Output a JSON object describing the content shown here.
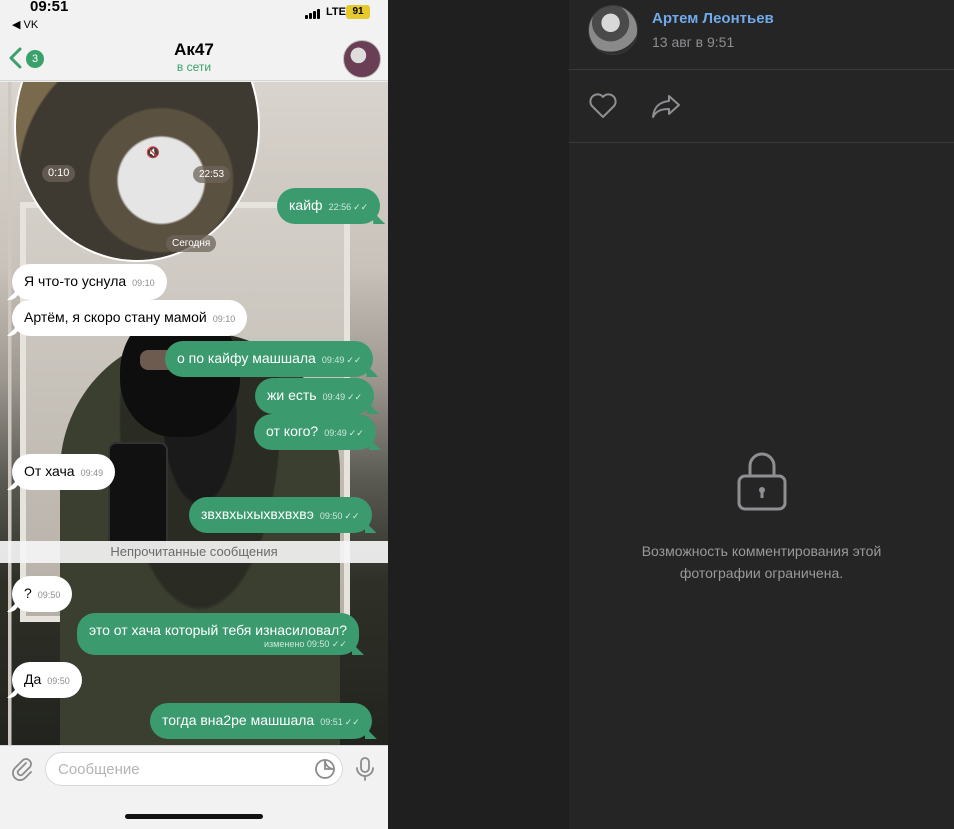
{
  "status_bar": {
    "time": "09:51",
    "back_app": "◀ VK",
    "network": "LTE",
    "battery": "91"
  },
  "chat_header": {
    "unread_count": "3",
    "title": "Ак47",
    "status": "в сети"
  },
  "video_message": {
    "elapsed": "0:10",
    "time": "22:53"
  },
  "date_divider": "Сегодня",
  "messages": [
    {
      "dir": "out",
      "text": "кайф",
      "time": "22:56"
    },
    {
      "dir": "in",
      "text": "Я что-то уснула",
      "time": "09:10"
    },
    {
      "dir": "in",
      "text": "Артём, я скоро стану мамой",
      "time": "09:10"
    },
    {
      "dir": "out",
      "text": "о по кайфу машшала",
      "time": "09:49"
    },
    {
      "dir": "out",
      "text": "жи есть",
      "time": "09:49"
    },
    {
      "dir": "out",
      "text": "от кого?",
      "time": "09:49"
    },
    {
      "dir": "in",
      "text": "От хача",
      "time": "09:49"
    },
    {
      "dir": "out",
      "text": "звхвхыхыхвхвхвэ",
      "time": "09:50"
    },
    {
      "dir": "in",
      "text": "?",
      "time": "09:50"
    },
    {
      "dir": "out",
      "text": "это от хача который тебя изнасиловал?",
      "time": "09:50",
      "edited": "изменено"
    },
    {
      "dir": "in",
      "text": "Да",
      "time": "09:50"
    },
    {
      "dir": "out",
      "text": "тогда вна2ре машшала",
      "time": "09:51"
    }
  ],
  "unread_divider": "Непрочитанные сообщения",
  "composer": {
    "placeholder": "Сообщение",
    "value": ""
  },
  "post": {
    "author": "Артем Леонтьев",
    "date": "13 авг в 9:51",
    "comments_restricted": "Возможность комментирования этой фотографии ограничена."
  },
  "colors": {
    "accent_green": "#3b9b6f",
    "vk_link": "#71aaeb",
    "vk_bg": "#252525"
  },
  "icons": [
    "back-chevron-icon",
    "attach-icon",
    "sticker-icon",
    "mic-icon",
    "like-icon",
    "share-icon",
    "lock-icon"
  ]
}
